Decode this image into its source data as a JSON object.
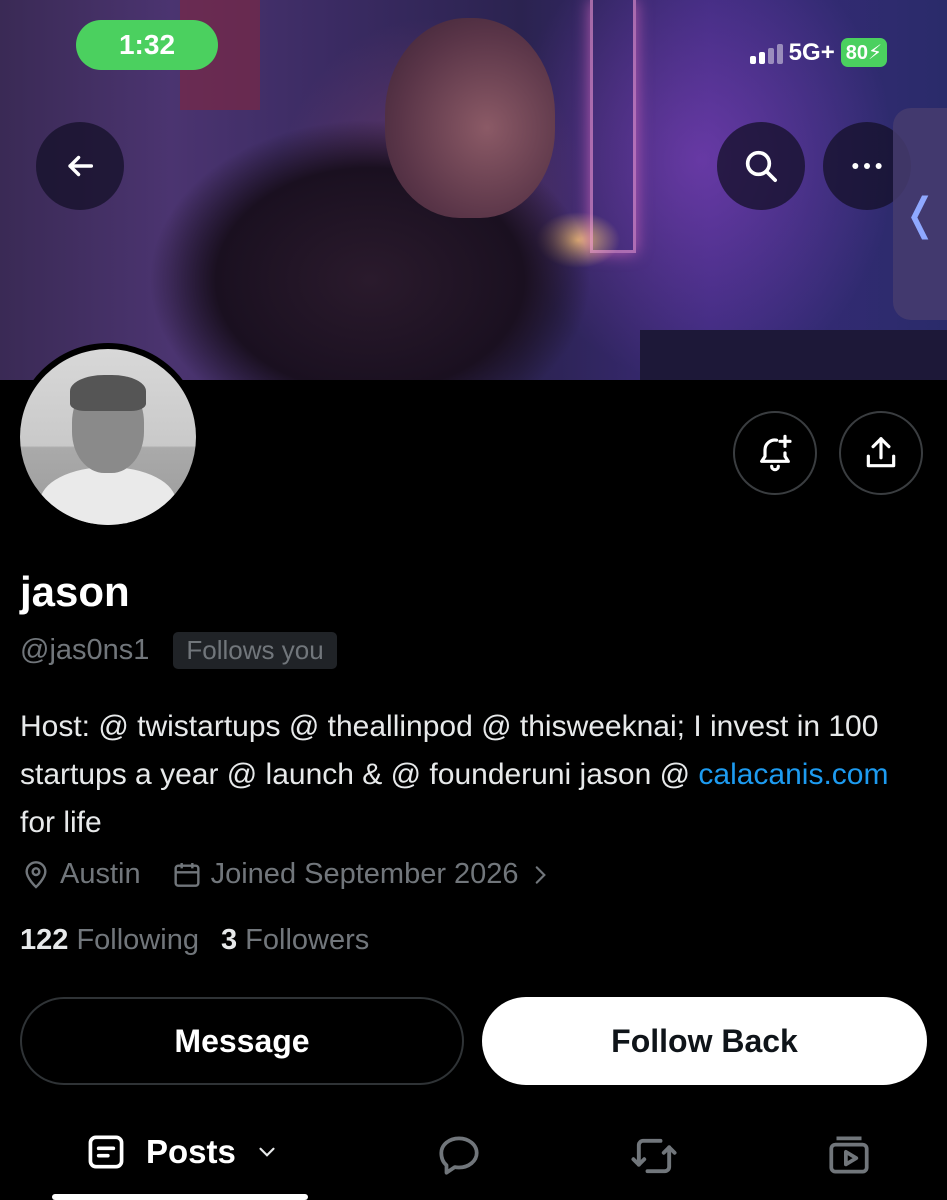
{
  "status_bar": {
    "time": "1:32",
    "network": "5G+",
    "battery": "80"
  },
  "header": {
    "back_icon": "arrow-left-icon",
    "search_icon": "search-icon",
    "more_icon": "more-horizontal-icon",
    "side_tab_glyph": "❬"
  },
  "profile": {
    "name": "jason",
    "handle": "@jas0ns1",
    "follows_you": "Follows you",
    "bio_text": "Host: @ twistartups @ theallinpod @ thisweeknai; I invest in 100 startups a year @ launch & @ founderuni jason @ ",
    "bio_link": "calacanis.com",
    "bio_end": " for life",
    "location": "Austin",
    "joined": "Joined September 2026",
    "following_count": "122",
    "following_label": "Following",
    "followers_count": "3",
    "followers_label": "Followers"
  },
  "actions": {
    "notify_icon": "bell-plus-icon",
    "share_icon": "share-icon",
    "message": "Message",
    "follow_back": "Follow Back"
  },
  "tabs": {
    "posts": "Posts",
    "replies_icon": "reply-icon",
    "reposts_icon": "repost-icon",
    "media_icon": "media-icon"
  },
  "colors": {
    "link": "#1d9bf0",
    "status_green": "#4bd05f",
    "muted": "#71767b"
  }
}
